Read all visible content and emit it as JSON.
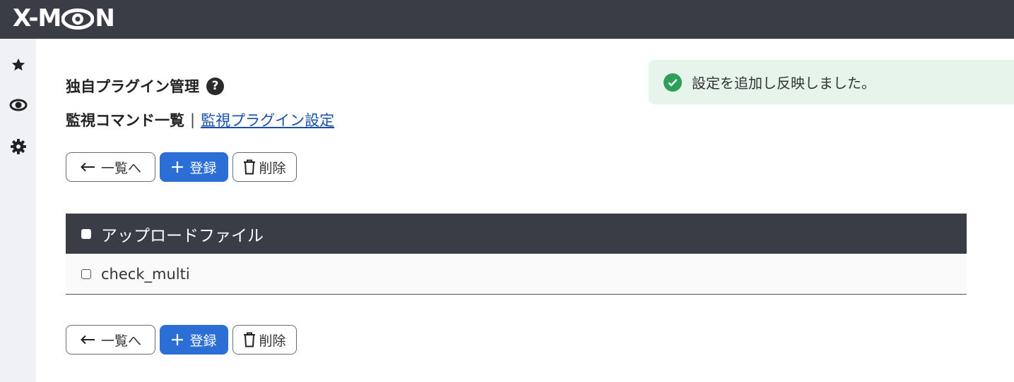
{
  "header": {
    "logo_left": "X-M",
    "logo_right": "N"
  },
  "sidebar": {
    "items": [
      {
        "icon": "star-icon"
      },
      {
        "icon": "eye-icon"
      },
      {
        "icon": "gear-icon"
      }
    ]
  },
  "page": {
    "title": "独自プラグイン管理",
    "help_label": "?",
    "subnav_current": "監視コマンド一覧",
    "subnav_separator": "|",
    "subnav_link": "監視プラグイン設定"
  },
  "toolbar": {
    "back_label": "一覧へ",
    "add_label": "登録",
    "delete_label": "削除"
  },
  "table": {
    "header": "アップロードファイル",
    "rows": [
      "check_multi"
    ]
  },
  "toast": {
    "message": "設定を追加し反映しました。"
  },
  "colors": {
    "topbar": "#3a3d46",
    "primary": "#2b6fd6",
    "success": "#2e9e5b",
    "toast_bg": "#e6f4ec",
    "link": "#1a4fa8"
  }
}
